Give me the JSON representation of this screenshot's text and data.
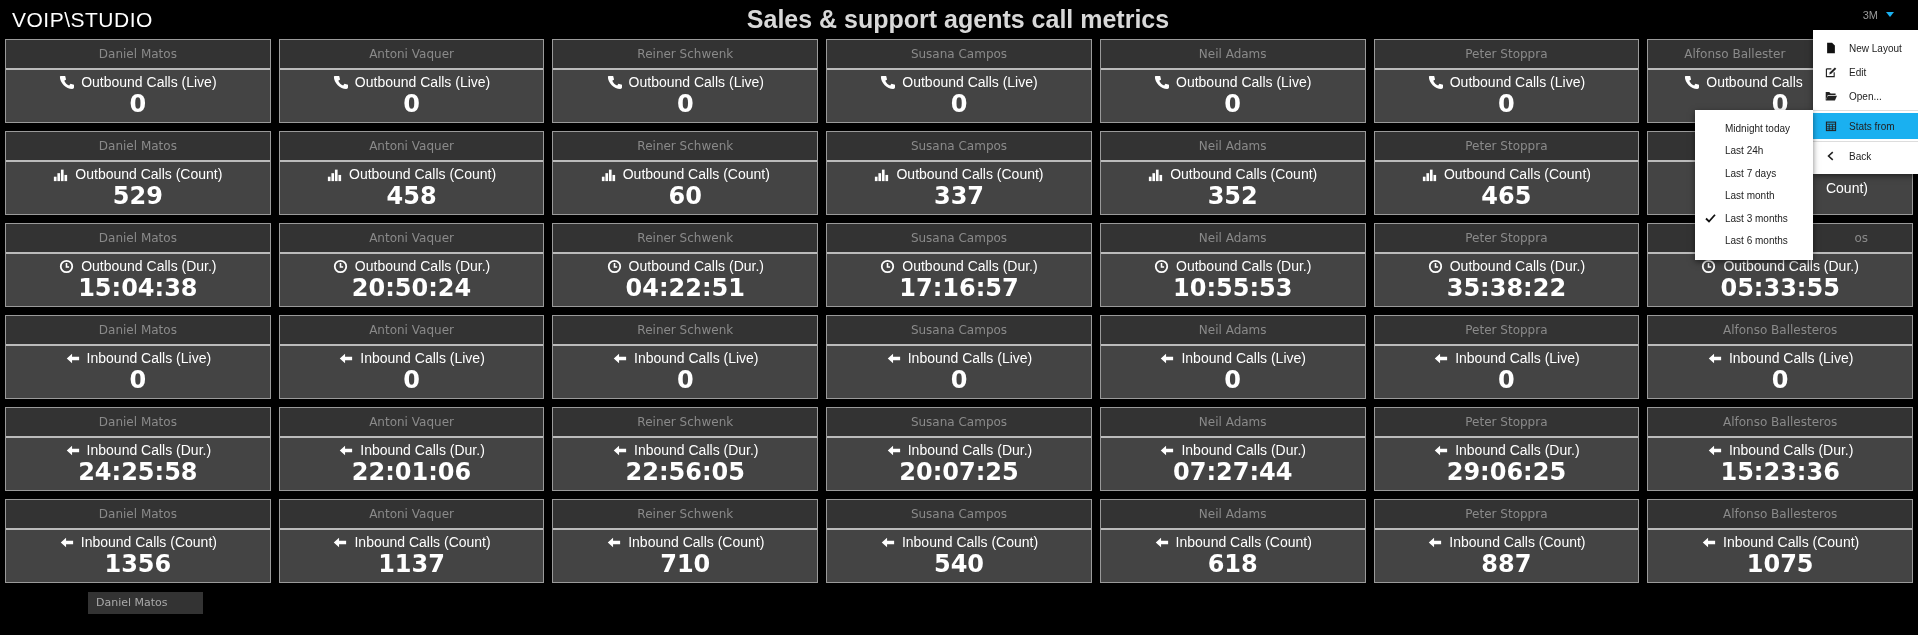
{
  "header": {
    "logo": "VOIP\\STUDIO",
    "title": "Sales & support agents call metrics",
    "period_button": "3M"
  },
  "grid": [
    {
      "cards": [
        {
          "name": "Daniel Matos",
          "kind": "phone",
          "label": "Outbound Calls (Live)",
          "value": "0"
        },
        {
          "name": "Antoni Vaquer",
          "kind": "phone",
          "label": "Outbound Calls (Live)",
          "value": "0"
        },
        {
          "name": "Reiner Schwenk",
          "kind": "phone",
          "label": "Outbound Calls (Live)",
          "value": "0"
        },
        {
          "name": "Susana Campos",
          "kind": "phone",
          "label": "Outbound Calls (Live)",
          "value": "0"
        },
        {
          "name": "Neil Adams",
          "kind": "phone",
          "label": "Outbound Calls (Live)",
          "value": "0"
        },
        {
          "name": "Peter Stoppra",
          "kind": "phone",
          "label": "Outbound Calls (Live)",
          "value": "0"
        },
        {
          "name": "Alfonso Ballester",
          "name_clipped_end": true,
          "kind": "phone",
          "label": "Outbound Calls",
          "label_clipped_end": true,
          "value": "0"
        }
      ]
    },
    {
      "cards": [
        {
          "name": "Daniel Matos",
          "kind": "bars",
          "label": "Outbound Calls (Count)",
          "value": "529"
        },
        {
          "name": "Antoni Vaquer",
          "kind": "bars",
          "label": "Outbound Calls (Count)",
          "value": "458"
        },
        {
          "name": "Reiner Schwenk",
          "kind": "bars",
          "label": "Outbound Calls (Count)",
          "value": "60"
        },
        {
          "name": "Susana Campos",
          "kind": "bars",
          "label": "Outbound Calls (Count)",
          "value": "337"
        },
        {
          "name": "Neil Adams",
          "kind": "bars",
          "label": "Outbound Calls (Count)",
          "value": "352"
        },
        {
          "name": "Peter Stoppra",
          "kind": "bars",
          "label": "Outbound Calls (Count)",
          "value": "465"
        },
        {
          "label": "Count)",
          "label_clipped_start": true
        }
      ]
    },
    {
      "cards": [
        {
          "name": "Daniel Matos",
          "kind": "clock",
          "label": "Outbound Calls (Dur.)",
          "value": "15:04:38"
        },
        {
          "name": "Antoni Vaquer",
          "kind": "clock",
          "label": "Outbound Calls (Dur.)",
          "value": "20:50:24"
        },
        {
          "name": "Reiner Schwenk",
          "kind": "clock",
          "label": "Outbound Calls (Dur.)",
          "value": "04:22:51"
        },
        {
          "name": "Susana Campos",
          "kind": "clock",
          "label": "Outbound Calls (Dur.)",
          "value": "17:16:57"
        },
        {
          "name": "Neil Adams",
          "kind": "clock",
          "label": "Outbound Calls (Dur.)",
          "value": "10:55:53"
        },
        {
          "name": "Peter Stoppra",
          "kind": "clock",
          "label": "Outbound Calls (Dur.)",
          "value": "35:38:22"
        },
        {
          "name": "os",
          "name_clipped_start": true,
          "kind": "clock",
          "label": "Outbound Calls (Dur.)",
          "value": "05:33:55"
        }
      ]
    },
    {
      "cards": [
        {
          "name": "Daniel Matos",
          "kind": "arrow",
          "label": "Inbound Calls (Live)",
          "value": "0"
        },
        {
          "name": "Antoni Vaquer",
          "kind": "arrow",
          "label": "Inbound Calls (Live)",
          "value": "0"
        },
        {
          "name": "Reiner Schwenk",
          "kind": "arrow",
          "label": "Inbound Calls (Live)",
          "value": "0"
        },
        {
          "name": "Susana Campos",
          "kind": "arrow",
          "label": "Inbound Calls (Live)",
          "value": "0"
        },
        {
          "name": "Neil Adams",
          "kind": "arrow",
          "label": "Inbound Calls (Live)",
          "value": "0"
        },
        {
          "name": "Peter Stoppra",
          "kind": "arrow",
          "label": "Inbound Calls (Live)",
          "value": "0"
        },
        {
          "name": "Alfonso Ballesteros",
          "kind": "arrow",
          "label": "Inbound Calls (Live)",
          "value": "0"
        }
      ]
    },
    {
      "cards": [
        {
          "name": "Daniel Matos",
          "kind": "arrow",
          "label": "Inbound Calls (Dur.)",
          "value": "24:25:58"
        },
        {
          "name": "Antoni Vaquer",
          "kind": "arrow",
          "label": "Inbound Calls (Dur.)",
          "value": "22:01:06"
        },
        {
          "name": "Reiner Schwenk",
          "kind": "arrow",
          "label": "Inbound Calls (Dur.)",
          "value": "22:56:05"
        },
        {
          "name": "Susana Campos",
          "kind": "arrow",
          "label": "Inbound Calls (Dur.)",
          "value": "20:07:25"
        },
        {
          "name": "Neil Adams",
          "kind": "arrow",
          "label": "Inbound Calls (Dur.)",
          "value": "07:27:44"
        },
        {
          "name": "Peter Stoppra",
          "kind": "arrow",
          "label": "Inbound Calls (Dur.)",
          "value": "29:06:25"
        },
        {
          "name": "Alfonso Ballesteros",
          "kind": "arrow",
          "label": "Inbound Calls (Dur.)",
          "value": "15:23:36"
        }
      ]
    },
    {
      "cards": [
        {
          "name": "Daniel Matos",
          "kind": "arrow",
          "label": "Inbound Calls (Count)",
          "value": "1356"
        },
        {
          "name": "Antoni Vaquer",
          "kind": "arrow",
          "label": "Inbound Calls (Count)",
          "value": "1137"
        },
        {
          "name": "Reiner Schwenk",
          "kind": "arrow",
          "label": "Inbound Calls (Count)",
          "value": "710"
        },
        {
          "name": "Susana Campos",
          "kind": "arrow",
          "label": "Inbound Calls (Count)",
          "value": "540"
        },
        {
          "name": "Neil Adams",
          "kind": "arrow",
          "label": "Inbound Calls (Count)",
          "value": "618"
        },
        {
          "name": "Peter Stoppra",
          "kind": "arrow",
          "label": "Inbound Calls (Count)",
          "value": "887"
        },
        {
          "name": "Alfonso Ballesteros",
          "kind": "arrow",
          "label": "Inbound Calls (Count)",
          "value": "1075"
        }
      ]
    }
  ],
  "drag_ghost": {
    "name": "Daniel Matos"
  },
  "menu": {
    "items": [
      {
        "kind": "file",
        "label": "New Layout",
        "selected": false
      },
      {
        "kind": "pencil",
        "label": "Edit",
        "selected": false
      },
      {
        "kind": "folder",
        "label": "Open...",
        "selected": false
      },
      {
        "kind": "calendar",
        "label": "Stats from",
        "selected": true
      },
      {
        "kind": "chevron",
        "label": "Back",
        "selected": false
      }
    ]
  },
  "submenu": {
    "items": [
      {
        "label": "Midnight today",
        "checked": false
      },
      {
        "label": "Last 24h",
        "checked": false
      },
      {
        "label": "Last 7 days",
        "checked": false
      },
      {
        "label": "Last month",
        "checked": false
      },
      {
        "label": "Last 3 months",
        "checked": true
      },
      {
        "label": "Last 6 months",
        "checked": false
      }
    ]
  }
}
